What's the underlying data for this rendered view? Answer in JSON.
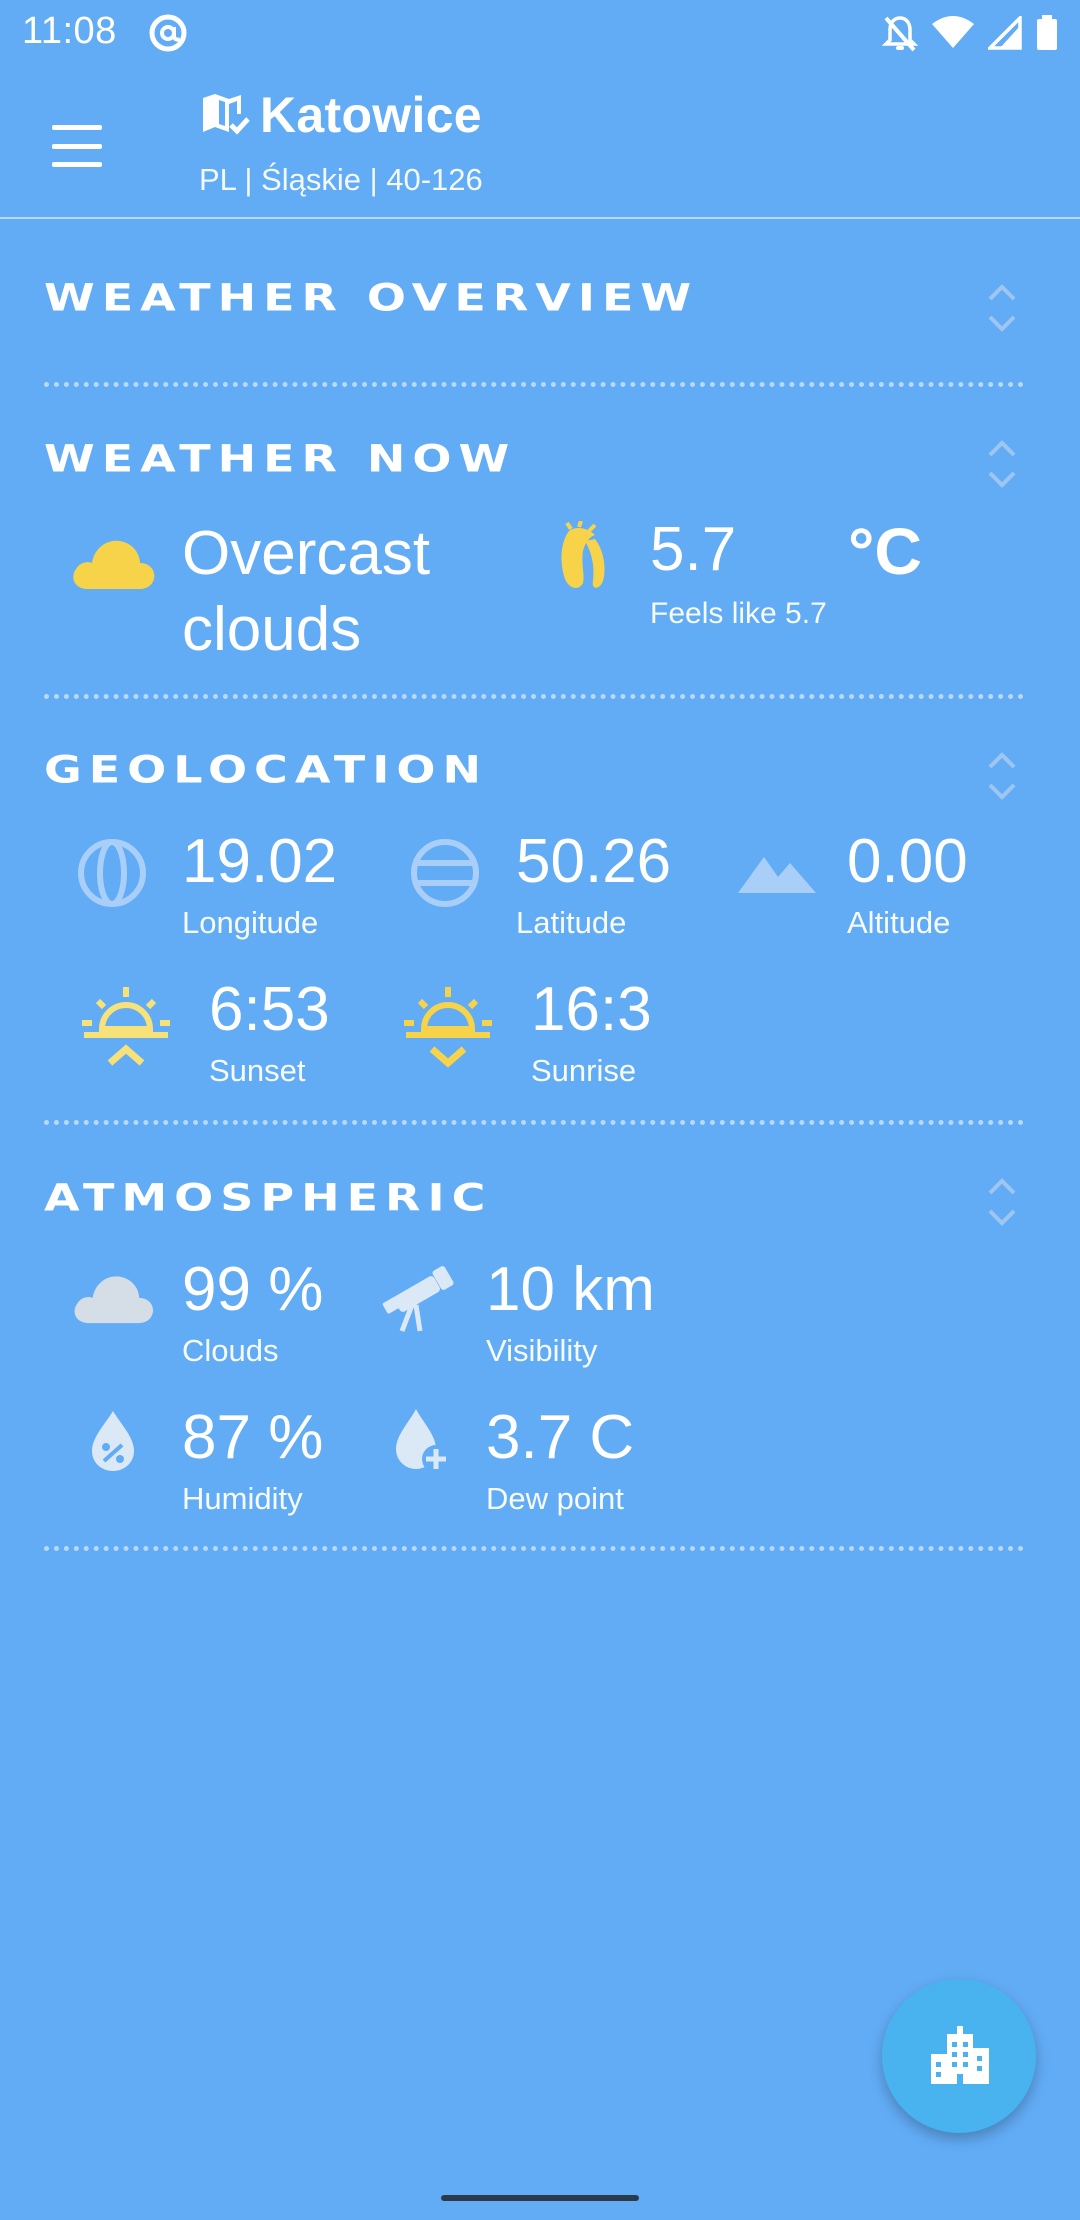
{
  "status_bar": {
    "time": "11:08"
  },
  "header": {
    "city": "Katowice",
    "subtitle": "PL | Śląskie | 40-126"
  },
  "sections": {
    "overview": {
      "title": "Weather Overview"
    },
    "now": {
      "title": "Weather Now",
      "condition_line1": "Overcast",
      "condition_line2": "clouds",
      "temperature": "5.7",
      "unit": "°C",
      "feels_like": "Feels like 5.7"
    },
    "geolocation": {
      "title": "Geolocation",
      "longitude": {
        "value": "19.02",
        "label": "Longitude"
      },
      "latitude": {
        "value": "50.26",
        "label": "Latitude"
      },
      "altitude": {
        "value": "0.00",
        "label": "Altitude"
      },
      "sunset": {
        "value": "6:53",
        "label": "Sunset"
      },
      "sunrise": {
        "value": "16:3",
        "label": "Sunrise"
      }
    },
    "atmospheric": {
      "title": "Atmospheric",
      "clouds": {
        "value": "99 %",
        "label": "Clouds"
      },
      "visibility": {
        "value": "10 km",
        "label": "Visibility"
      },
      "humidity": {
        "value": "87 %",
        "label": "Humidity"
      },
      "dew_point": {
        "value": "3.7 C",
        "label": "Dew point"
      }
    }
  },
  "colors": {
    "background": "#62acf6",
    "accent_yellow": "#f7d34a",
    "light_blue_icon": "#a9cff8",
    "fab": "#49b3ef"
  },
  "icons": {
    "menu": "hamburger-icon",
    "location": "map-check-icon",
    "fab": "city-buildings-icon"
  }
}
